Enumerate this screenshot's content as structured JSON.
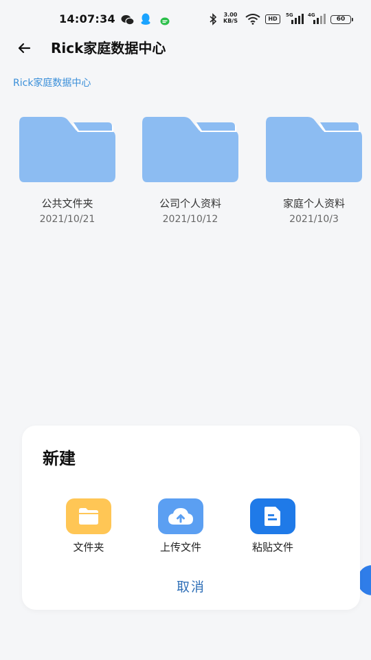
{
  "status_bar": {
    "time": "14:07:34",
    "net_speed_value": "3.00",
    "net_speed_unit": "KB/S",
    "hd_label": "HD",
    "signal1_label": "5G",
    "signal2_label": "4G",
    "battery": "60"
  },
  "header": {
    "title": "Rick家庭数据中心"
  },
  "breadcrumb": {
    "current": "Rick家庭数据中心"
  },
  "folders": [
    {
      "name": "公共文件夹",
      "date": "2021/10/21"
    },
    {
      "name": "公司个人资料",
      "date": "2021/10/12"
    },
    {
      "name": "家庭个人资料",
      "date": "2021/10/3"
    }
  ],
  "new_sheet": {
    "title": "新建",
    "actions": [
      {
        "label": "文件夹",
        "icon": "folder-icon",
        "color": "#ffc655"
      },
      {
        "label": "上传文件",
        "icon": "cloud-upload-icon",
        "color": "#5b9ff2"
      },
      {
        "label": "粘贴文件",
        "icon": "document-icon",
        "color": "#1f7ae8"
      }
    ],
    "cancel": "取消"
  },
  "colors": {
    "folder": "#8cbcf2",
    "accent": "#3a8fd9",
    "background": "#f5f6f8"
  }
}
